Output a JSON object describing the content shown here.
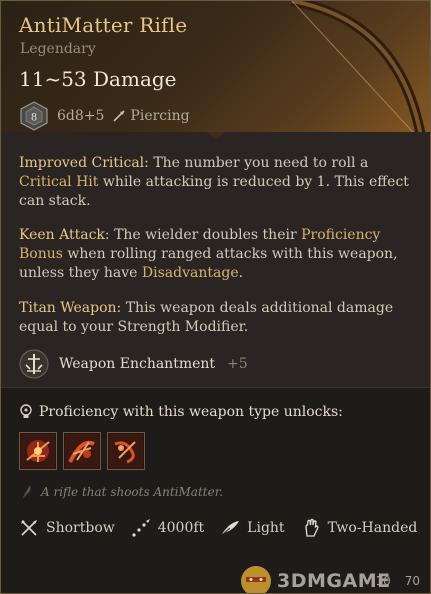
{
  "item": {
    "name": "AntiMatter Rifle",
    "rarity": "Legendary",
    "damage": "11~53 Damage",
    "die_face": "8",
    "dice": "6d8+5",
    "damage_type": "Piercing"
  },
  "abilities": [
    {
      "name": "Improved Critical:",
      "text_1": " The number you need to roll a ",
      "highlight_1": "Critical Hit",
      "text_2": " while attacking is reduced by 1. This effect can stack."
    },
    {
      "name": "Keen Attack:",
      "text_1": " The wielder doubles their ",
      "highlight_1": "Proficiency Bonus",
      "text_2": " when rolling ranged attacks with this weapon, unless they have ",
      "highlight_2": "Disadvantage",
      "text_3": "."
    },
    {
      "name": "Titan Weapon:",
      "text_1": " This weapon deals additional damage equal to your Strength Modifier."
    }
  ],
  "enchantment": {
    "label": "Weapon Enchantment",
    "bonus": "+5"
  },
  "proficiency": {
    "label": "Proficiency with this weapon type unlocks:"
  },
  "flavor": "A rifle that shoots AntiMatter.",
  "properties": {
    "type": "Shortbow",
    "range": "4000ft",
    "weight_class": "Light",
    "handedness": "Two-Handed"
  },
  "footer": {
    "watermark": "3DMGAME",
    "value_1": "10",
    "value_2": "70"
  },
  "colors": {
    "gold_title": "#e8c687",
    "keyword": "#e8c687",
    "highlight": "#d7b36f",
    "body_text": "#d4cab8",
    "panel_bg": "#2a2522"
  }
}
